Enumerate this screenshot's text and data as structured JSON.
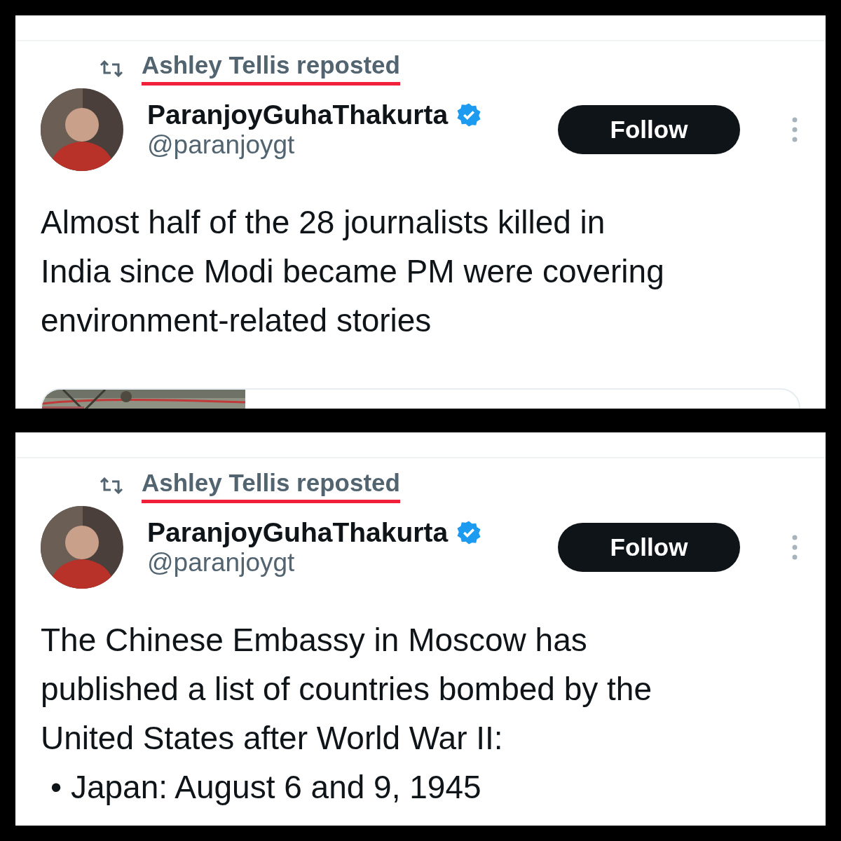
{
  "panels": [
    {
      "repost": {
        "label": "Ashley Tellis reposted",
        "underlined": true
      },
      "author": {
        "name": "ParanjoyGuhaThakurta",
        "verified": true,
        "handle": "@paranjoygt"
      },
      "follow": "Follow",
      "text_lines": [
        "Almost half of the 28 journalists killed in",
        "India since Modi became PM were covering",
        "environment-related stories"
      ]
    },
    {
      "repost": {
        "label": "Ashley Tellis reposted",
        "underlined": true
      },
      "author": {
        "name": "ParanjoyGuhaThakurta",
        "verified": true,
        "handle": "@paranjoygt"
      },
      "follow": "Follow",
      "text_lines": [
        "The Chinese Embassy in Moscow has",
        "published a list of countries bombed by the",
        "United States after World War II:"
      ],
      "bullets": [
        "• Japan: August 6 and 9, 1945"
      ]
    }
  ]
}
